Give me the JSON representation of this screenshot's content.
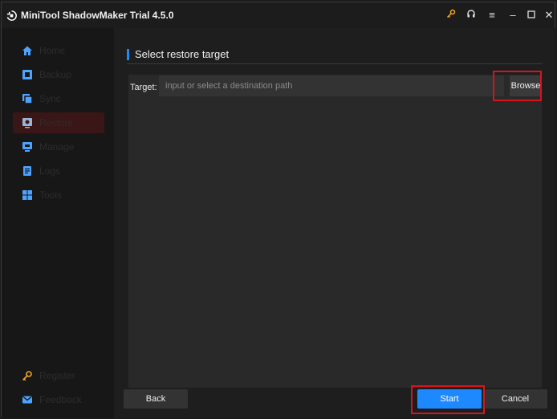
{
  "app": {
    "title": "MiniTool ShadowMaker Trial 4.5.0"
  },
  "titlebar_icons": [
    "key-icon",
    "headphones-icon",
    "menu-icon",
    "minimize-icon",
    "maximize-icon",
    "close-icon"
  ],
  "sidebar": {
    "items": [
      {
        "label": "Home",
        "icon": "home-icon"
      },
      {
        "label": "Backup",
        "icon": "backup-icon"
      },
      {
        "label": "Sync",
        "icon": "sync-icon"
      },
      {
        "label": "Restore",
        "icon": "restore-icon",
        "active": true
      },
      {
        "label": "Manage",
        "icon": "manage-icon"
      },
      {
        "label": "Logs",
        "icon": "logs-icon"
      },
      {
        "label": "Tools",
        "icon": "tools-icon"
      }
    ],
    "bottom_items": [
      {
        "label": "Register",
        "icon": "key-icon"
      },
      {
        "label": "Feedback",
        "icon": "mail-icon"
      }
    ]
  },
  "main": {
    "section_title": "Select restore target",
    "target_label": "Target:",
    "target_placeholder": "input or select a destination path",
    "target_value": "",
    "browse_label": "Browse"
  },
  "footer": {
    "back_label": "Back",
    "start_label": "Start",
    "cancel_label": "Cancel"
  },
  "colors": {
    "accent": "#1e88ff",
    "highlight": "#d7141e",
    "active_nav": "#3a1616",
    "icon_blue": "#4da3ff",
    "key_orange": "#f5a623"
  }
}
